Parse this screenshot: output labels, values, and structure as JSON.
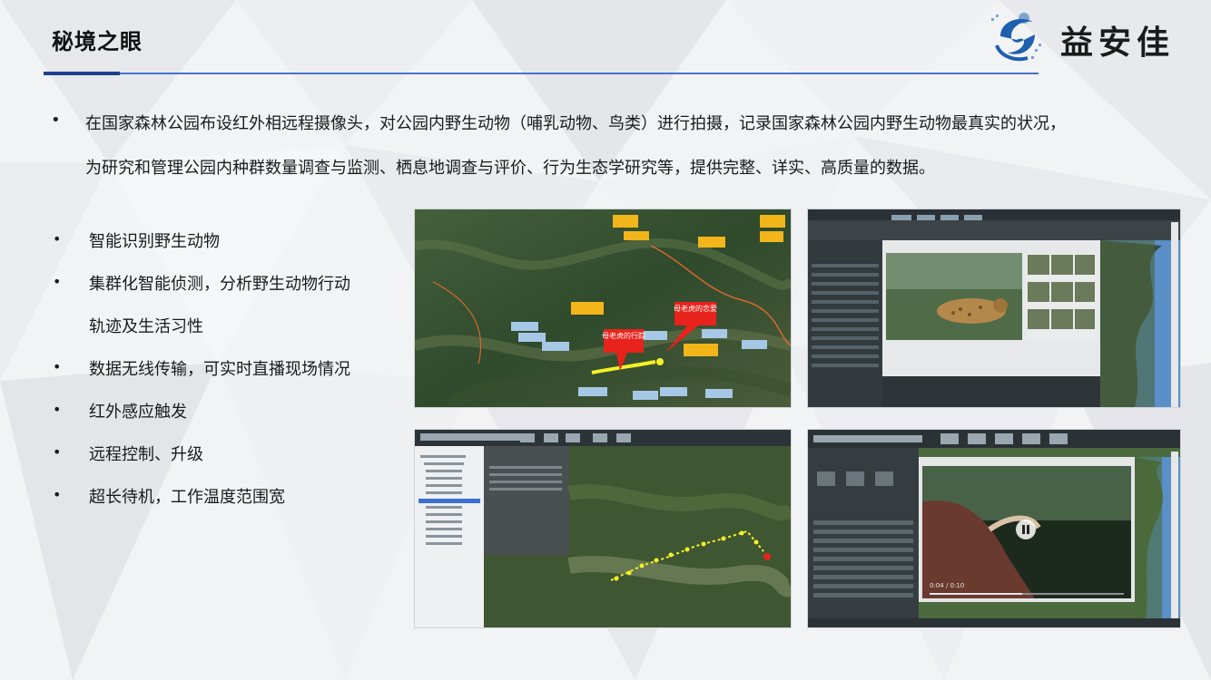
{
  "header": {
    "title": "秘境之眼",
    "logo_text": "益安佳"
  },
  "intro": {
    "bullet": "•",
    "line1": "在国家森林公园布设红外相远程摄像头，对公园内野生动物（哺乳动物、鸟类）进行拍摄，记录国家森林公园内野生动物最真实的状况，",
    "line2": "为研究和管理公园内种群数量调查与监测、栖息地调查与评价、行为生态学研究等，提供完整、详实、高质量的数据。"
  },
  "features": [
    {
      "bullet": "•",
      "text": "智能识别野生动物"
    },
    {
      "bullet": "•",
      "text": "集群化智能侦测，分析野生动物行动"
    },
    {
      "bullet": "",
      "text": "轨迹及生活习性"
    },
    {
      "bullet": "•",
      "text": "数据无线传输，可实时直播现场情况"
    },
    {
      "bullet": "•",
      "text": "红外感应触发"
    },
    {
      "bullet": "•",
      "text": "远程控制、升级"
    },
    {
      "bullet": "•",
      "text": "超长待机，工作温度范围宽"
    }
  ],
  "screenshots": {
    "map_track": {
      "callout_a": "母老虎的行踪",
      "callout_b": "母老虎的恋爱"
    },
    "video_player": {
      "time": "0:04 / 0:10"
    }
  },
  "colors": {
    "title_rule": "#4a73c9",
    "title_rule_dark": "#1e3f8a",
    "logo_blue": "#1f5fb0",
    "callout_red": "#e8231b",
    "label_yellow": "#f2b51a",
    "track_yellow": "#f4f227"
  }
}
